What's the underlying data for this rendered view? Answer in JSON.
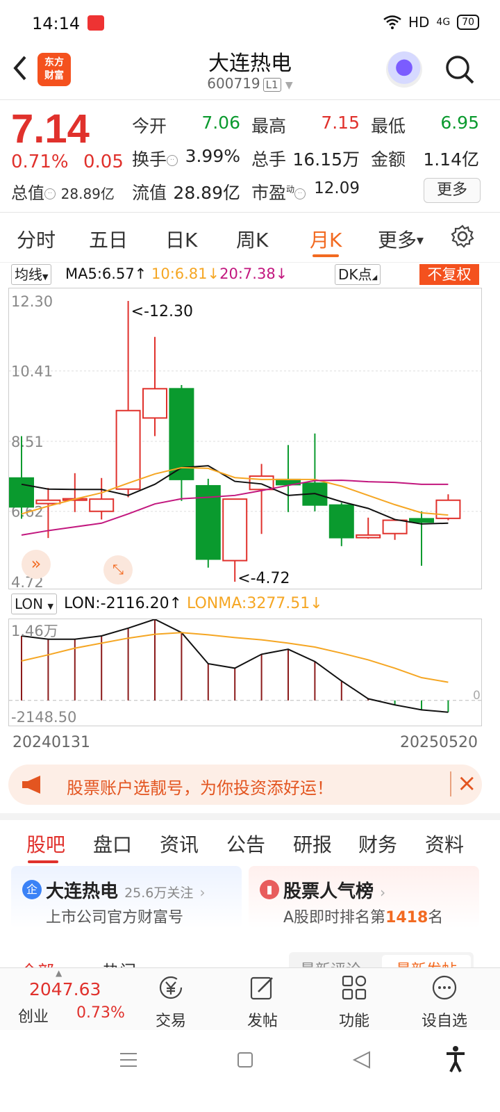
{
  "status_bar": {
    "time": "14:14",
    "network": "HD",
    "signal": "4G",
    "battery": "70"
  },
  "header": {
    "stock_name": "大连热电",
    "stock_code": "600719",
    "level_badge": "L1"
  },
  "quote": {
    "price": "7.14",
    "change_pct": "0.71%",
    "change_abs": "0.05",
    "total_value_label": "总值",
    "total_value": "28.89亿",
    "open_label": "今开",
    "open": "7.06",
    "high_label": "最高",
    "high": "7.15",
    "low_label": "最低",
    "low": "6.95",
    "turnover_label": "换手",
    "turnover": "3.99%",
    "volume_label": "总手",
    "volume": "16.15万",
    "amount_label": "金额",
    "amount": "1.14亿",
    "float_value_label": "流值",
    "float_value": "28.89亿",
    "pe_label": "市盈",
    "pe_superscript": "动",
    "pe": "12.09",
    "more_label": "更多"
  },
  "chart_tabs": [
    {
      "label": "分时",
      "active": false
    },
    {
      "label": "五日",
      "active": false
    },
    {
      "label": "日K",
      "active": false
    },
    {
      "label": "周K",
      "active": false
    },
    {
      "label": "月K",
      "active": true
    },
    {
      "label": "更多",
      "active": false
    }
  ],
  "ma_bar": {
    "select_label": "均线",
    "ma5": "MA5:6.57↑",
    "ma10": "10:6.81↓",
    "ma20": "20:7.38↓",
    "dk_label": "DK点",
    "fuquan_label": "不复权"
  },
  "lon_bar": {
    "select_label": "LON",
    "lon": "LON:-2116.20↑",
    "lonma": "LONMA:3277.51↓"
  },
  "colors": {
    "up": "#e0312c",
    "down": "#0a9a2e",
    "accent": "#f26a21",
    "ma5": "#111111",
    "ma10": "#f5a623",
    "ma20": "#c2177e"
  },
  "chart_data": {
    "type": "candlestick",
    "ylim": [
      4.72,
      12.3
    ],
    "y_ticks": [
      "12.30",
      "10.41",
      "8.51",
      "6.62",
      "4.72"
    ],
    "max_label": "<-12.30",
    "min_label": "<-4.72",
    "candles": [
      {
        "open": 7.52,
        "close": 6.74,
        "high": 8.65,
        "low": 6.42
      },
      {
        "open": 6.83,
        "close": 6.92,
        "high": 7.25,
        "low": 5.9
      },
      {
        "open": 6.92,
        "close": 6.96,
        "high": 7.65,
        "low": 6.6
      },
      {
        "open": 6.62,
        "close": 6.95,
        "high": 7.52,
        "low": 6.4
      },
      {
        "open": 7.22,
        "close": 9.34,
        "high": 12.3,
        "low": 7.0
      },
      {
        "open": 9.14,
        "close": 9.93,
        "high": 11.33,
        "low": 8.65
      },
      {
        "open": 9.93,
        "close": 7.48,
        "high": 10.03,
        "low": 6.9
      },
      {
        "open": 7.31,
        "close": 5.33,
        "high": 7.5,
        "low": 5.1
      },
      {
        "open": 5.29,
        "close": 6.95,
        "high": 6.95,
        "low": 4.72
      },
      {
        "open": 7.21,
        "close": 7.57,
        "high": 7.9,
        "low": 6.01
      },
      {
        "open": 7.48,
        "close": 7.34,
        "high": 8.41,
        "low": 6.6
      },
      {
        "open": 7.38,
        "close": 6.79,
        "high": 8.72,
        "low": 6.62
      },
      {
        "open": 6.79,
        "close": 5.91,
        "high": 6.85,
        "low": 5.68
      },
      {
        "open": 5.91,
        "close": 5.98,
        "high": 6.45,
        "low": 5.88
      },
      {
        "open": 6.02,
        "close": 6.38,
        "high": 6.4,
        "low": 5.85
      },
      {
        "open": 6.42,
        "close": 6.33,
        "high": 6.62,
        "low": 5.15
      },
      {
        "open": 6.43,
        "close": 6.92,
        "high": 7.08,
        "low": 6.38
      }
    ],
    "ma5": [
      7.35,
      7.22,
      7.21,
      7.21,
      7.05,
      7.35,
      7.8,
      7.85,
      7.43,
      7.36,
      7.05,
      7.1,
      6.88,
      6.7,
      6.4,
      6.28,
      6.3
    ],
    "ma10": [
      6.55,
      6.76,
      6.95,
      7.12,
      7.38,
      7.63,
      7.8,
      7.78,
      7.53,
      7.48,
      7.48,
      7.48,
      7.3,
      7.05,
      6.8,
      6.58,
      6.52
    ],
    "ma20": [
      5.98,
      6.1,
      6.2,
      6.3,
      6.55,
      6.82,
      6.96,
      7.0,
      7.05,
      7.18,
      7.32,
      7.45,
      7.46,
      7.42,
      7.4,
      7.35,
      7.35
    ],
    "lon": {
      "ylim": [
        -2148.5,
        14600
      ],
      "y_ticks": [
        "1.46万",
        "-2148.50"
      ],
      "zero_label": "0",
      "values": [
        11600,
        11000,
        11000,
        11600,
        13000,
        14600,
        12200,
        6600,
        5800,
        8300,
        9200,
        7000,
        3500,
        300,
        -800,
        -1700,
        -2116
      ],
      "lonma": [
        7100,
        8200,
        9400,
        10300,
        11200,
        11900,
        12200,
        11800,
        11300,
        10900,
        10300,
        9600,
        8500,
        7300,
        5800,
        4100,
        3278
      ]
    },
    "x_start": "20240131",
    "x_end": "20250520"
  },
  "ad": {
    "text": "股票账户选靓号，为你投资添好运！"
  },
  "info_tabs": [
    {
      "label": "股吧",
      "active": true
    },
    {
      "label": "盘口",
      "active": false
    },
    {
      "label": "资讯",
      "active": false
    },
    {
      "label": "公告",
      "active": false
    },
    {
      "label": "研报",
      "active": false
    },
    {
      "label": "财务",
      "active": false
    },
    {
      "label": "资料",
      "active": false
    }
  ],
  "company_card": {
    "icon": "企",
    "title": "大连热电",
    "followers": "25.6万关注",
    "subtitle": "上市公司官方财富号"
  },
  "rank_card": {
    "title": "股票人气榜",
    "subtitle_prefix": "A股即时排名第",
    "rank": "1418",
    "subtitle_suffix": "名"
  },
  "feed_tabs": {
    "all": "全部",
    "hot": "热门",
    "latest_comment": "最新评论",
    "latest_post": "最新发帖"
  },
  "bottom_nav": {
    "index_value": "2047.63",
    "index_name": "创业",
    "index_pct": "0.73%",
    "items": [
      {
        "label": "交易",
        "icon": "yen-icon"
      },
      {
        "label": "发帖",
        "icon": "edit-icon"
      },
      {
        "label": "功能",
        "icon": "apps-icon"
      },
      {
        "label": "设自选",
        "icon": "more-icon"
      }
    ]
  }
}
